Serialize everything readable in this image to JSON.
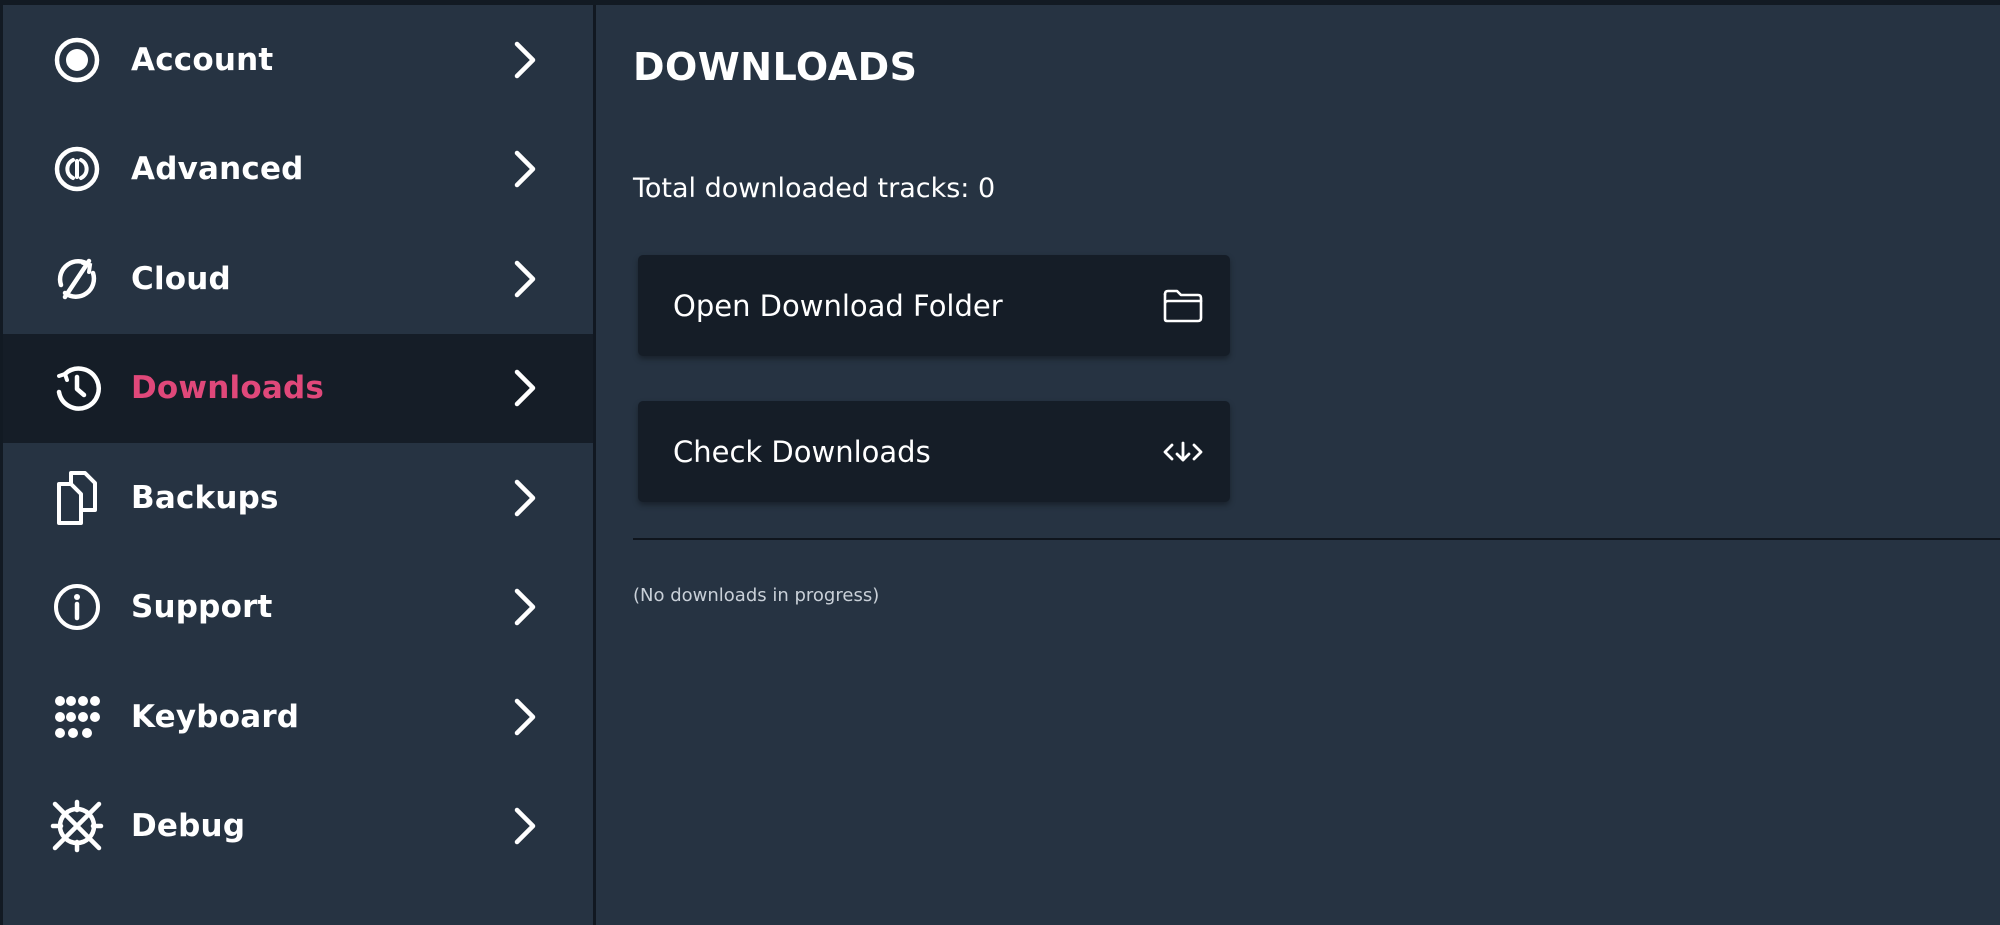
{
  "sidebar": {
    "items": [
      {
        "label": "Account",
        "icon": "account-circle-icon",
        "active": false
      },
      {
        "label": "Advanced",
        "icon": "advanced-power-icon",
        "active": false
      },
      {
        "label": "Cloud",
        "icon": "cloud-sync-icon",
        "active": false
      },
      {
        "label": "Downloads",
        "icon": "downloads-clock-icon",
        "active": true
      },
      {
        "label": "Backups",
        "icon": "backups-files-icon",
        "active": false
      },
      {
        "label": "Support",
        "icon": "info-icon",
        "active": false
      },
      {
        "label": "Keyboard",
        "icon": "keyboard-dots-icon",
        "active": false
      },
      {
        "label": "Debug",
        "icon": "debug-icon",
        "active": false
      }
    ]
  },
  "main": {
    "title": "DOWNLOADS",
    "total_tracks_text": "Total downloaded tracks: 0",
    "buttons": [
      {
        "label": "Open Download Folder",
        "icon": "folder-open-icon"
      },
      {
        "label": "Check Downloads",
        "icon": "check-downloads-icon"
      }
    ],
    "status_note": "(No downloads in progress)"
  },
  "colors": {
    "background": "#263342",
    "active_item_bg": "#151d27",
    "accent": "#e0487a",
    "button_bg": "#151d27"
  }
}
